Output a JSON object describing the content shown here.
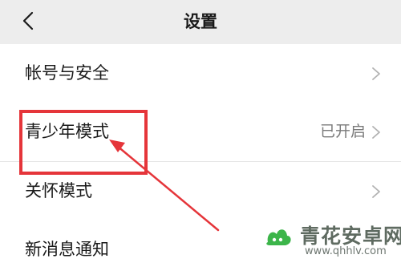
{
  "header": {
    "title": "设置",
    "back_icon": "chevron-left-icon"
  },
  "groups": [
    {
      "items": [
        {
          "label": "帐号与安全",
          "value": ""
        }
      ]
    },
    {
      "items": [
        {
          "label": "青少年模式",
          "value": "已开启"
        },
        {
          "label": "关怀模式",
          "value": ""
        }
      ]
    },
    {
      "items": [
        {
          "label": "新消息通知",
          "value": ""
        }
      ]
    }
  ],
  "annotation": {
    "color": "#e5353a",
    "highlighted_item": "青少年模式"
  },
  "watermark": {
    "text": "青花安卓网",
    "url": "www.qhhlv.com",
    "logo_color": "#3cb54a"
  },
  "colors": {
    "background": "#ededed",
    "card": "#ffffff",
    "chevron": "#b2b2b2"
  }
}
